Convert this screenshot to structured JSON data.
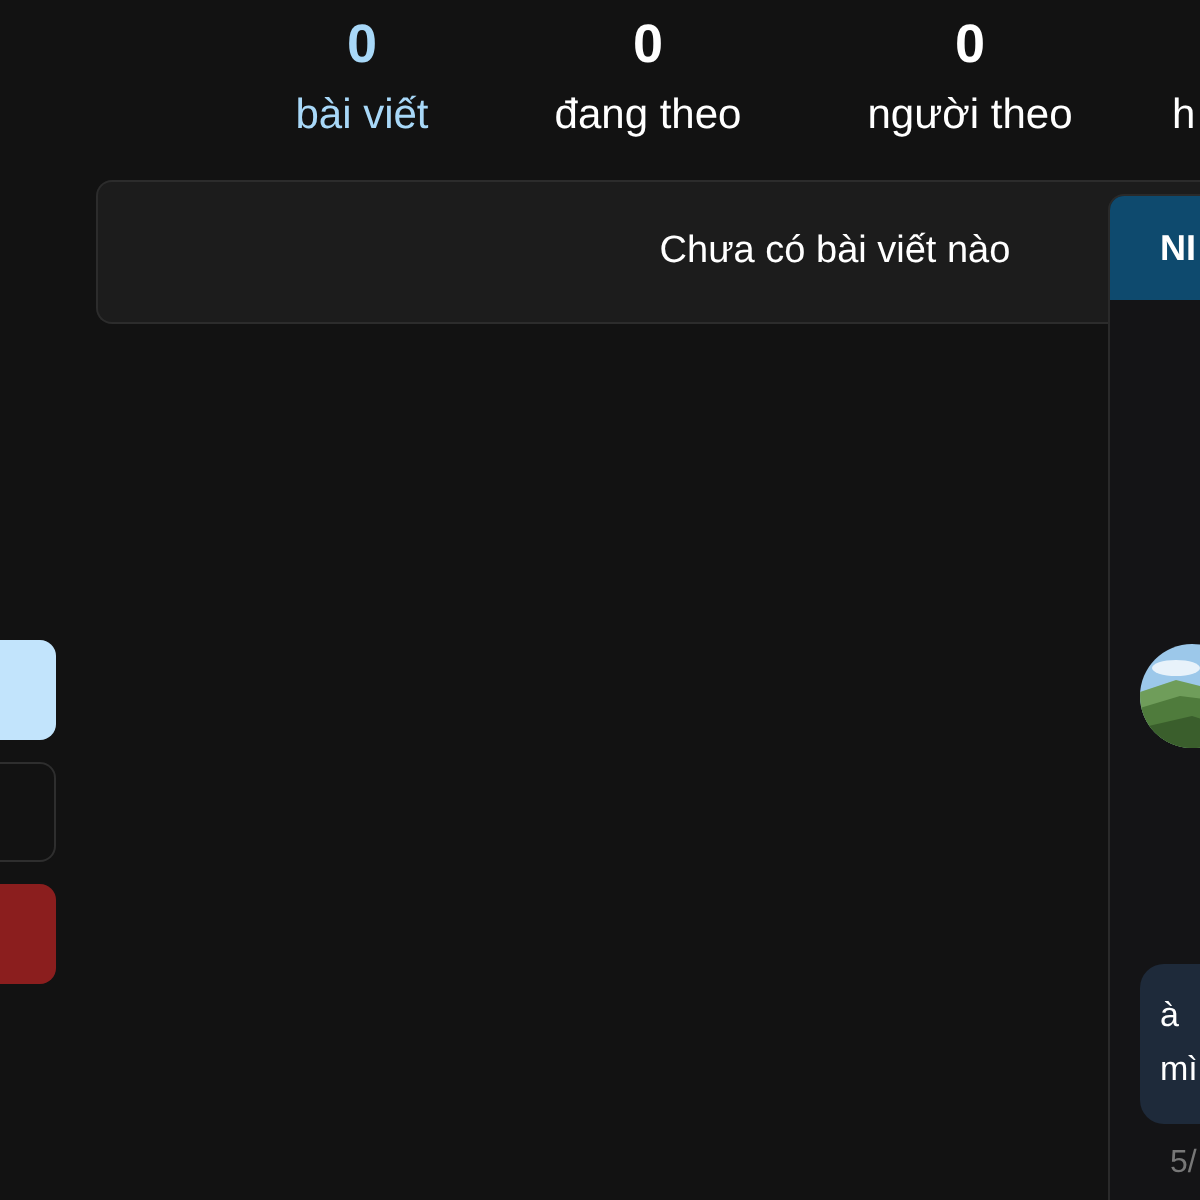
{
  "stats": [
    {
      "value": "0",
      "label": "bài viết",
      "selected": true
    },
    {
      "value": "0",
      "label": "đang theo",
      "selected": false
    },
    {
      "value": "0",
      "label": "người theo",
      "selected": false
    },
    {
      "label": "h",
      "selected": false
    }
  ],
  "posts": {
    "empty_message": "Chưa có bài viết nào"
  },
  "side_buttons": [
    {
      "kind": "primary"
    },
    {
      "kind": "outline"
    },
    {
      "kind": "danger"
    }
  ],
  "chat": {
    "title": "NI",
    "message": {
      "lines": [
        "à",
        "mì"
      ],
      "time": "5/"
    }
  }
}
